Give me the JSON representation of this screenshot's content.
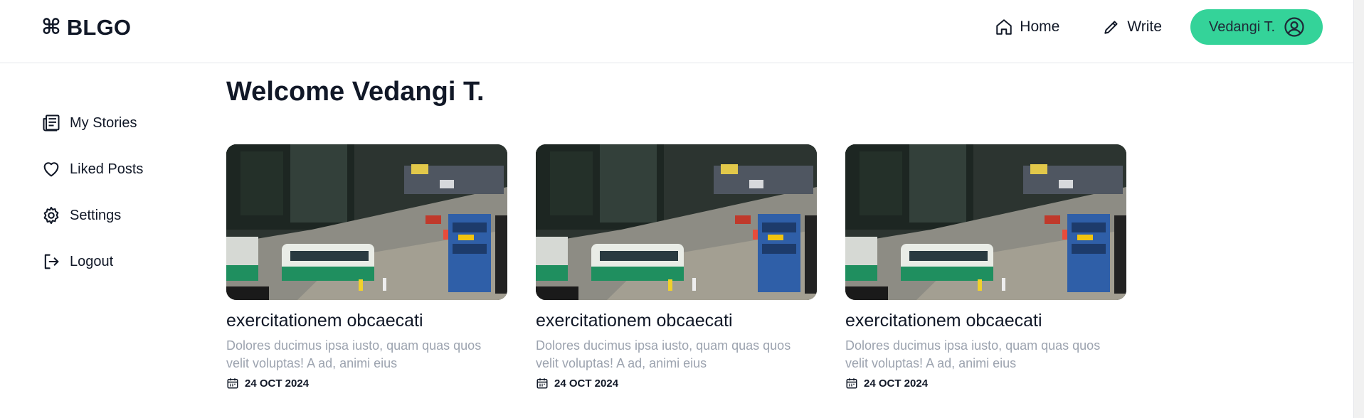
{
  "header": {
    "logo_mark": "⌘",
    "logo_text": "BLGO",
    "nav": {
      "home_label": "Home",
      "write_label": "Write",
      "user_name": "Vedangi T."
    }
  },
  "sidebar": {
    "items": [
      {
        "label": "My Stories",
        "icon": "newspaper-icon"
      },
      {
        "label": "Liked Posts",
        "icon": "heart-icon"
      },
      {
        "label": "Settings",
        "icon": "gear-icon"
      },
      {
        "label": "Logout",
        "icon": "logout-icon"
      }
    ]
  },
  "main": {
    "welcome": "Welcome Vedangi T.",
    "posts": [
      {
        "title": "exercitationem obcaecati",
        "description": "Dolores ducimus ipsa iusto, quam quas quos velit voluptas! A ad, animi eius",
        "date": "24 OCT 2024"
      },
      {
        "title": "exercitationem obcaecati",
        "description": "Dolores ducimus ipsa iusto, quam quas quos velit voluptas! A ad, animi eius",
        "date": "24 OCT 2024"
      },
      {
        "title": "exercitationem obcaecati",
        "description": "Dolores ducimus ipsa iusto, quam quas quos velit voluptas! A ad, animi eius",
        "date": "24 OCT 2024"
      }
    ]
  },
  "colors": {
    "accent": "#34d399",
    "text": "#111827",
    "muted": "#9ca3af"
  }
}
